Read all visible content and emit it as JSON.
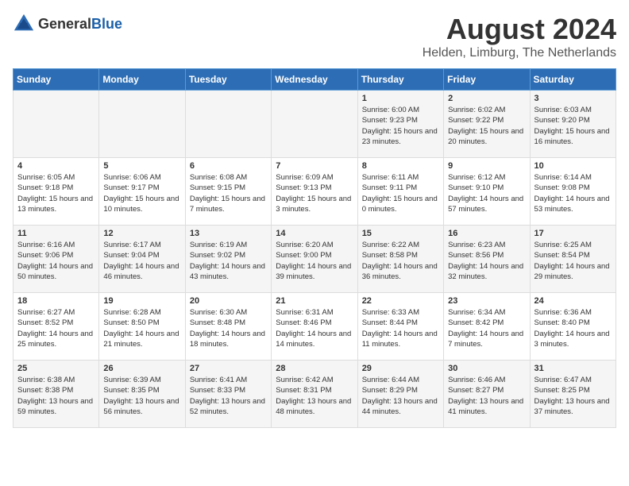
{
  "header": {
    "logo_general": "General",
    "logo_blue": "Blue",
    "title": "August 2024",
    "subtitle": "Helden, Limburg, The Netherlands"
  },
  "calendar": {
    "days_of_week": [
      "Sunday",
      "Monday",
      "Tuesday",
      "Wednesday",
      "Thursday",
      "Friday",
      "Saturday"
    ],
    "weeks": [
      [
        {
          "day": "",
          "info": ""
        },
        {
          "day": "",
          "info": ""
        },
        {
          "day": "",
          "info": ""
        },
        {
          "day": "",
          "info": ""
        },
        {
          "day": "1",
          "info": "Sunrise: 6:00 AM\nSunset: 9:23 PM\nDaylight: 15 hours and 23 minutes."
        },
        {
          "day": "2",
          "info": "Sunrise: 6:02 AM\nSunset: 9:22 PM\nDaylight: 15 hours and 20 minutes."
        },
        {
          "day": "3",
          "info": "Sunrise: 6:03 AM\nSunset: 9:20 PM\nDaylight: 15 hours and 16 minutes."
        }
      ],
      [
        {
          "day": "4",
          "info": "Sunrise: 6:05 AM\nSunset: 9:18 PM\nDaylight: 15 hours and 13 minutes."
        },
        {
          "day": "5",
          "info": "Sunrise: 6:06 AM\nSunset: 9:17 PM\nDaylight: 15 hours and 10 minutes."
        },
        {
          "day": "6",
          "info": "Sunrise: 6:08 AM\nSunset: 9:15 PM\nDaylight: 15 hours and 7 minutes."
        },
        {
          "day": "7",
          "info": "Sunrise: 6:09 AM\nSunset: 9:13 PM\nDaylight: 15 hours and 3 minutes."
        },
        {
          "day": "8",
          "info": "Sunrise: 6:11 AM\nSunset: 9:11 PM\nDaylight: 15 hours and 0 minutes."
        },
        {
          "day": "9",
          "info": "Sunrise: 6:12 AM\nSunset: 9:10 PM\nDaylight: 14 hours and 57 minutes."
        },
        {
          "day": "10",
          "info": "Sunrise: 6:14 AM\nSunset: 9:08 PM\nDaylight: 14 hours and 53 minutes."
        }
      ],
      [
        {
          "day": "11",
          "info": "Sunrise: 6:16 AM\nSunset: 9:06 PM\nDaylight: 14 hours and 50 minutes."
        },
        {
          "day": "12",
          "info": "Sunrise: 6:17 AM\nSunset: 9:04 PM\nDaylight: 14 hours and 46 minutes."
        },
        {
          "day": "13",
          "info": "Sunrise: 6:19 AM\nSunset: 9:02 PM\nDaylight: 14 hours and 43 minutes."
        },
        {
          "day": "14",
          "info": "Sunrise: 6:20 AM\nSunset: 9:00 PM\nDaylight: 14 hours and 39 minutes."
        },
        {
          "day": "15",
          "info": "Sunrise: 6:22 AM\nSunset: 8:58 PM\nDaylight: 14 hours and 36 minutes."
        },
        {
          "day": "16",
          "info": "Sunrise: 6:23 AM\nSunset: 8:56 PM\nDaylight: 14 hours and 32 minutes."
        },
        {
          "day": "17",
          "info": "Sunrise: 6:25 AM\nSunset: 8:54 PM\nDaylight: 14 hours and 29 minutes."
        }
      ],
      [
        {
          "day": "18",
          "info": "Sunrise: 6:27 AM\nSunset: 8:52 PM\nDaylight: 14 hours and 25 minutes."
        },
        {
          "day": "19",
          "info": "Sunrise: 6:28 AM\nSunset: 8:50 PM\nDaylight: 14 hours and 21 minutes."
        },
        {
          "day": "20",
          "info": "Sunrise: 6:30 AM\nSunset: 8:48 PM\nDaylight: 14 hours and 18 minutes."
        },
        {
          "day": "21",
          "info": "Sunrise: 6:31 AM\nSunset: 8:46 PM\nDaylight: 14 hours and 14 minutes."
        },
        {
          "day": "22",
          "info": "Sunrise: 6:33 AM\nSunset: 8:44 PM\nDaylight: 14 hours and 11 minutes."
        },
        {
          "day": "23",
          "info": "Sunrise: 6:34 AM\nSunset: 8:42 PM\nDaylight: 14 hours and 7 minutes."
        },
        {
          "day": "24",
          "info": "Sunrise: 6:36 AM\nSunset: 8:40 PM\nDaylight: 14 hours and 3 minutes."
        }
      ],
      [
        {
          "day": "25",
          "info": "Sunrise: 6:38 AM\nSunset: 8:38 PM\nDaylight: 13 hours and 59 minutes."
        },
        {
          "day": "26",
          "info": "Sunrise: 6:39 AM\nSunset: 8:35 PM\nDaylight: 13 hours and 56 minutes."
        },
        {
          "day": "27",
          "info": "Sunrise: 6:41 AM\nSunset: 8:33 PM\nDaylight: 13 hours and 52 minutes."
        },
        {
          "day": "28",
          "info": "Sunrise: 6:42 AM\nSunset: 8:31 PM\nDaylight: 13 hours and 48 minutes."
        },
        {
          "day": "29",
          "info": "Sunrise: 6:44 AM\nSunset: 8:29 PM\nDaylight: 13 hours and 44 minutes."
        },
        {
          "day": "30",
          "info": "Sunrise: 6:46 AM\nSunset: 8:27 PM\nDaylight: 13 hours and 41 minutes."
        },
        {
          "day": "31",
          "info": "Sunrise: 6:47 AM\nSunset: 8:25 PM\nDaylight: 13 hours and 37 minutes."
        }
      ]
    ]
  }
}
